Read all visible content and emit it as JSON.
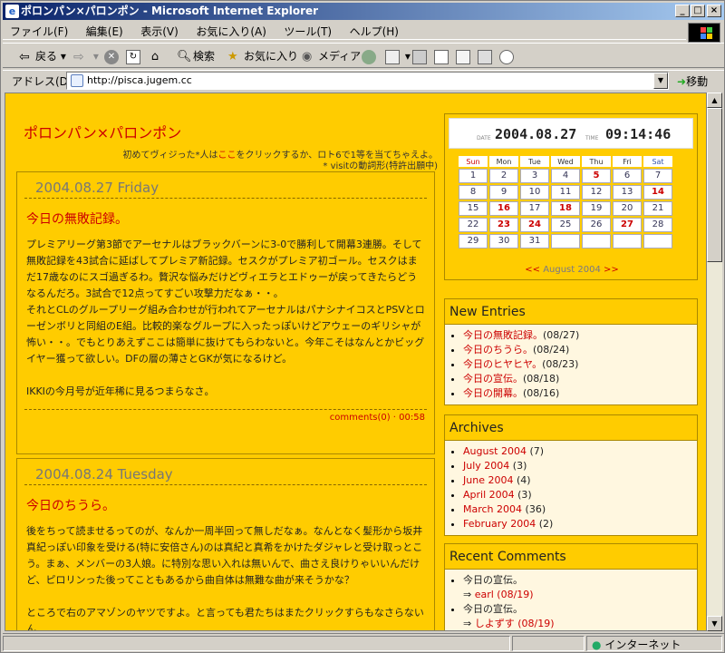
{
  "window": {
    "title": "ポロンパン×パロンポン - Microsoft Internet Explorer"
  },
  "menu": [
    "ファイル(F)",
    "編集(E)",
    "表示(V)",
    "お気に入り(A)",
    "ツール(T)",
    "ヘルプ(H)"
  ],
  "toolbar": {
    "back": "戻る",
    "search": "検索",
    "favorites": "お気に入り",
    "media": "メディア"
  },
  "address": {
    "label": "アドレス(D)",
    "url": "http://pisca.jugem.cc",
    "go": "移動"
  },
  "status": {
    "zone": "インターネット"
  },
  "blog": {
    "title": "ポロンパン×パロンポン",
    "sub_line1_a": "初めてヴィジった*人は",
    "sub_link": "ここ",
    "sub_line1_b": "をクリックするか、ロト6で1等を当てちゃえよ。",
    "sub_line2": "* visitの動詞形(特許出願中)"
  },
  "entries": [
    {
      "date": "2004.08.27 Friday",
      "title": "今日の無敗記録。",
      "body": [
        "プレミアリーグ第3節でアーセナルはブラックバーンに3-0で勝利して開幕3連勝。そして無敗記録を43試合に延ばしてプレミア新記録。セスクがプレミア初ゴール。セスクはまだ17歳なのにスゴ過ぎるわ。贅沢な悩みだけどヴィエラとエドゥーが戻ってきたらどうなるんだろ。3試合で12点ってすごい攻撃力だなぁ・・。",
        "それとCLのグループリーグ組み合わせが行われてアーセナルはパナシナイコスとPSVとローゼンボリと同組のE組。比較的楽なグループに入ったっぽいけどアウェーのギリシャが怖い・・。でもとりあえずここは簡単に抜けてもらわないと。今年こそはなんとかビッグイヤー獲って欲しい。DFの層の薄さとGKが気になるけど。",
        "",
        "IKKIの今月号が近年稀に見るつまらなさ。"
      ],
      "comments": "comments(0)",
      "time": "00:58"
    },
    {
      "date": "2004.08.24 Tuesday",
      "title": "今日のちうら。",
      "body": [
        "後をちって読ませるってのが、なんか一周半回って無しだなぁ。なんとなく髪形から坂井真紀っぽい印象を受ける(特に安倍さん)のは真紀と真希をかけたダジャレと受け取っとこう。まぁ、メンバーの3人娘。に特別な思い入れは無いんで、曲さえ良けりゃいいんだけど、ピロリンった後ってこともあるから曲自体は無難な曲が来そうかな？",
        "",
        "ところで右のアマゾンのヤツですよ。と言っても君たちはまたクリックすらもなさらないん"
      ]
    }
  ],
  "clock": {
    "date_label": "DATE",
    "date": "2004.08.27",
    "time_label": "TIME",
    "time": "09:14:46"
  },
  "calendar": {
    "days": [
      "Sun",
      "Mon",
      "Tue",
      "Wed",
      "Thu",
      "Fri",
      "Sat"
    ],
    "weeks": [
      [
        "1",
        "2",
        "3",
        "4",
        "5",
        "6",
        "7"
      ],
      [
        "8",
        "9",
        "10",
        "11",
        "12",
        "13",
        "14"
      ],
      [
        "15",
        "16",
        "17",
        "18",
        "19",
        "20",
        "21"
      ],
      [
        "22",
        "23",
        "24",
        "25",
        "26",
        "27",
        "28"
      ],
      [
        "29",
        "30",
        "31",
        "",
        "",
        "",
        ""
      ]
    ],
    "red_days": [
      "5",
      "14",
      "16",
      "18",
      "23",
      "24",
      "27"
    ],
    "prev": "<<",
    "month": "August 2004",
    "next": ">>"
  },
  "new_entries": {
    "heading": "New Entries",
    "items": [
      {
        "title": "今日の無敗記録。",
        "date": "(08/27)"
      },
      {
        "title": "今日のちうら。",
        "date": "(08/24)"
      },
      {
        "title": "今日のヒヤヒヤ。",
        "date": "(08/23)"
      },
      {
        "title": "今日の宣伝。",
        "date": "(08/18)"
      },
      {
        "title": "今日の開幕。",
        "date": "(08/16)"
      }
    ]
  },
  "archives": {
    "heading": "Archives",
    "items": [
      {
        "title": "August 2004",
        "count": "(7)"
      },
      {
        "title": "July 2004",
        "count": "(3)"
      },
      {
        "title": "June 2004",
        "count": "(4)"
      },
      {
        "title": "April 2004",
        "count": "(3)"
      },
      {
        "title": "March 2004",
        "count": "(36)"
      },
      {
        "title": "February 2004",
        "count": "(2)"
      }
    ]
  },
  "recent_comments": {
    "heading": "Recent Comments",
    "items": [
      {
        "entry": "今日の宣伝。",
        "arrow": "⇒",
        "who": "earl (08/19)"
      },
      {
        "entry": "今日の宣伝。",
        "arrow": "⇒",
        "who": "しよずす (08/19)"
      }
    ]
  }
}
